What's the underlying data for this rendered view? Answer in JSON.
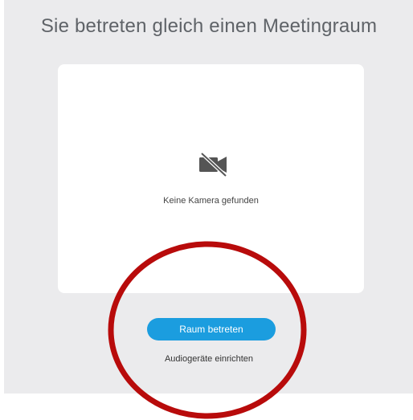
{
  "lobby": {
    "title": "Sie betreten gleich einen Meetingraum"
  },
  "preview": {
    "camera_icon": "camera-off-icon",
    "status_text": "Keine Kamera gefunden"
  },
  "actions": {
    "join_label": "Raum betreten",
    "audio_setup_label": "Audiogeräte einrichten"
  },
  "colors": {
    "background": "#ebebed",
    "accent": "#1b9ddf",
    "annotation": "#b80b0b",
    "icon": "#555555"
  }
}
